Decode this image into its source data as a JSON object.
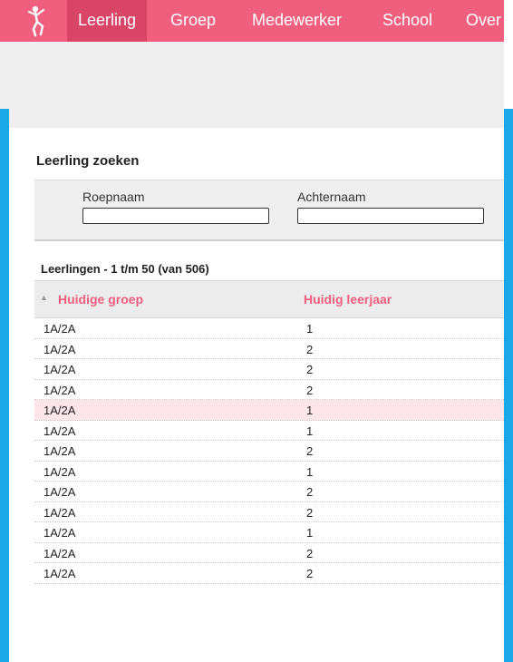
{
  "nav": {
    "items": [
      "Leerling",
      "Groep",
      "Medewerker",
      "School",
      "Over"
    ],
    "active": "Leerling"
  },
  "colors": {
    "brand": "#f0607e",
    "brand_active": "#d94566",
    "frame": "#1aa9e6",
    "row_highlight": "#fde6ea"
  },
  "search": {
    "title": "Leerling zoeken",
    "roepnaam_label": "Roepnaam",
    "roepnaam_value": "",
    "achternaam_label": "Achternaam",
    "achternaam_value": ""
  },
  "list": {
    "heading": "Leerlingen - 1 t/m 50 (van 506)",
    "columns": [
      "Huidige groep",
      "Huidig leerjaar"
    ],
    "sort_icon": "sort-ascending-icon",
    "rows": [
      {
        "groep": "1A/2A",
        "leerjaar": "1",
        "highlight": false
      },
      {
        "groep": "1A/2A",
        "leerjaar": "2",
        "highlight": false
      },
      {
        "groep": "1A/2A",
        "leerjaar": "2",
        "highlight": false
      },
      {
        "groep": "1A/2A",
        "leerjaar": "2",
        "highlight": false
      },
      {
        "groep": "1A/2A",
        "leerjaar": "1",
        "highlight": true
      },
      {
        "groep": "1A/2A",
        "leerjaar": "1",
        "highlight": false
      },
      {
        "groep": "1A/2A",
        "leerjaar": "2",
        "highlight": false
      },
      {
        "groep": "1A/2A",
        "leerjaar": "1",
        "highlight": false
      },
      {
        "groep": "1A/2A",
        "leerjaar": "2",
        "highlight": false
      },
      {
        "groep": "1A/2A",
        "leerjaar": "2",
        "highlight": false
      },
      {
        "groep": "1A/2A",
        "leerjaar": "1",
        "highlight": false
      },
      {
        "groep": "1A/2A",
        "leerjaar": "2",
        "highlight": false
      },
      {
        "groep": "1A/2A",
        "leerjaar": "2",
        "highlight": false
      }
    ]
  }
}
